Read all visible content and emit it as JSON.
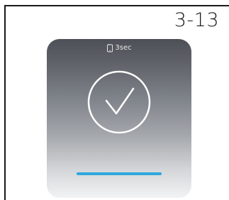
{
  "figure_label": "3-13",
  "screen": {
    "timer_text": "3sec",
    "timer_icon": "phone-touch-icon",
    "status_icon": "checkmark-circle-icon",
    "progress": 1.0,
    "progress_color": "#2ea8dc"
  }
}
